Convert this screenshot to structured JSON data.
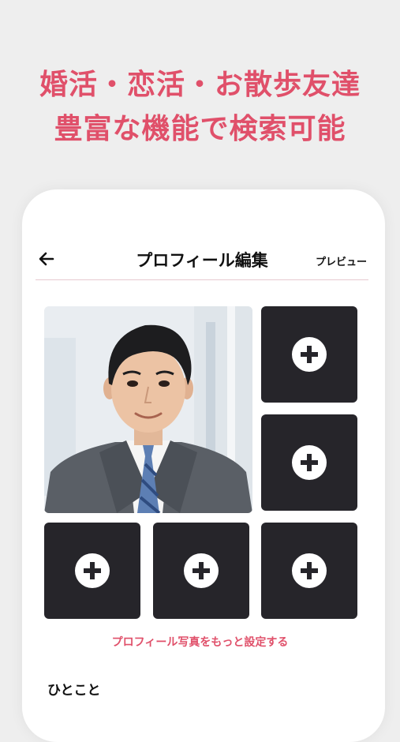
{
  "promo": {
    "line1": "婚活・恋活・お散歩友達",
    "line2": "豊富な機能で検索可能",
    "color": "#e0506a"
  },
  "header": {
    "back_icon": "arrow-left-icon",
    "title": "プロフィール編集",
    "preview_label": "プレビュー"
  },
  "photos": {
    "main_photo": "profile-photo-man-in-suit",
    "empty_slot_icon": "plus-circle-icon",
    "empty_slot_count": 5,
    "slot_color": "#26252a"
  },
  "more_photos_link": "プロフィール写真をもっと設定する",
  "section": {
    "label": "ひとこと"
  }
}
